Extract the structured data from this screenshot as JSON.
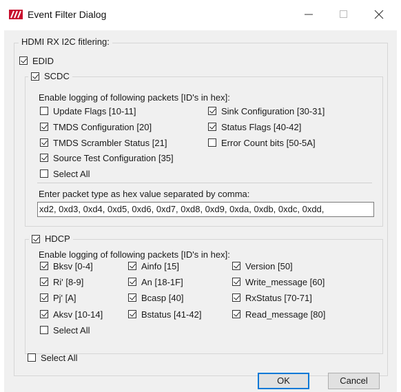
{
  "window": {
    "title": "Event Filter Dialog",
    "icon": "app-logo-icon",
    "controls": [
      "minimize-icon",
      "maximize-icon",
      "close-icon"
    ]
  },
  "main_group": {
    "label": "HDMI RX I2C fitlering:"
  },
  "edid": {
    "label": "EDID",
    "checked": true
  },
  "scdc": {
    "label": "SCDC",
    "checked": true,
    "caption": "Enable logging of following packets [ID's in hex]:",
    "items": [
      {
        "label": "Update Flags [10-11]",
        "checked": false
      },
      {
        "label": "TMDS Configuration [20]",
        "checked": true
      },
      {
        "label": "TMDS Scrambler Status [21]",
        "checked": true
      },
      {
        "label": "Source Test Configuration [35]",
        "checked": true
      },
      {
        "label": "Select All",
        "checked": false
      },
      {
        "label": "Sink Configuration [30-31]",
        "checked": true
      },
      {
        "label": "Status Flags [40-42]",
        "checked": true
      },
      {
        "label": "Error Count bits [50-5A]",
        "checked": false
      }
    ],
    "hex_caption": "Enter packet type as hex value separated by comma:",
    "hex_value": "xd2, 0xd3, 0xd4, 0xd5, 0xd6, 0xd7, 0xd8, 0xd9, 0xda, 0xdb, 0xdc, 0xdd,"
  },
  "hdcp": {
    "label": "HDCP",
    "checked": true,
    "caption": "Enable logging of following packets [ID's in hex]:",
    "items": [
      {
        "label": "Bksv [0-4]",
        "checked": true
      },
      {
        "label": "Ri' [8-9]",
        "checked": true
      },
      {
        "label": "Pj' [A]",
        "checked": true
      },
      {
        "label": "Aksv [10-14]",
        "checked": true
      },
      {
        "label": "Select All",
        "checked": false
      },
      {
        "label": "Ainfo [15]",
        "checked": true
      },
      {
        "label": "An [18-1F]",
        "checked": true
      },
      {
        "label": "Bcasp [40]",
        "checked": true
      },
      {
        "label": "Bstatus [41-42]",
        "checked": true
      },
      {
        "label": "Version [50]",
        "checked": true
      },
      {
        "label": "Write_message [60]",
        "checked": true
      },
      {
        "label": "RxStatus [70-71]",
        "checked": true
      },
      {
        "label": "Read_message [80]",
        "checked": true
      }
    ]
  },
  "select_all_global": {
    "label": "Select All",
    "checked": false
  },
  "buttons": {
    "ok": "OK",
    "cancel": "Cancel"
  },
  "colors": {
    "accent": "#0078d7",
    "logo": "#c8102e"
  }
}
